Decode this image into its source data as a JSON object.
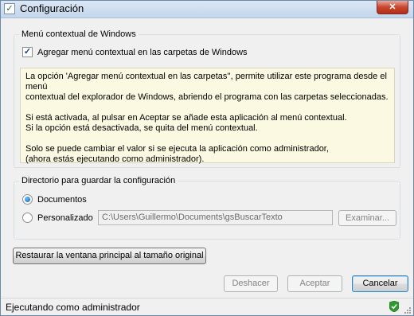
{
  "window": {
    "title": "Configuración",
    "close_glyph": "✕"
  },
  "context_menu_group": {
    "label": "Menú contextual de Windows",
    "checkbox_label": "Agregar menú contextual en las carpetas de Windows",
    "checkbox_checked": true,
    "info_paragraphs": [
      "La opción 'Agregar menú contextual en las carpetas'', permite utilizar este programa desde el menú\ncontextual del explorador de Windows, abriendo el programa con las carpetas seleccionadas.",
      "Si está activada, al pulsar en Aceptar se añade esta aplicación al menú contextual.\nSi la opción está desactivada, se quita del menú contextual.",
      "Solo se puede cambiar el valor si se ejecuta la aplicación como administrador,\n(ahora estás ejecutando como administrador)."
    ]
  },
  "config_dir_group": {
    "label": "Directorio para guardar la configuración",
    "option_documents": "Documentos",
    "option_custom": "Personalizado",
    "selected": "Documentos",
    "path_value": "C:\\Users\\Guillermo\\Documents\\gsBuscarTexto",
    "browse_label": "Examinar..."
  },
  "restore_button_label": "Restaurar la ventana principal al tamaño original",
  "buttons": {
    "undo": "Deshacer",
    "accept": "Aceptar",
    "cancel": "Cancelar"
  },
  "status": {
    "text": "Ejecutando como administrador",
    "icon": "shield-check-icon"
  },
  "colors": {
    "info_background": "#fbf9e1",
    "window_background": "#f0f0f0"
  }
}
